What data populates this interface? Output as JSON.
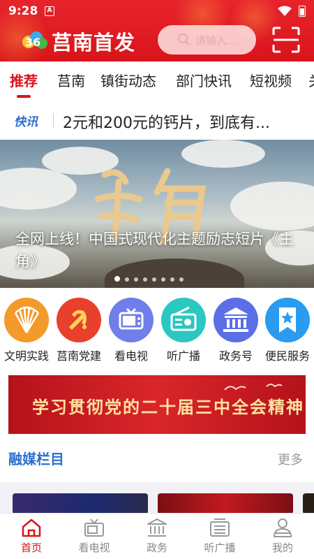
{
  "status_bar": {
    "time": "9:28",
    "app_badge": "A"
  },
  "header": {
    "brand": "莒南首发",
    "search_placeholder": "请输入..."
  },
  "tabs": [
    {
      "label": "推荐",
      "active": true
    },
    {
      "label": "莒南"
    },
    {
      "label": "镇街动态"
    },
    {
      "label": "部门快讯"
    },
    {
      "label": "短视频"
    },
    {
      "label": "关"
    }
  ],
  "flash": {
    "tag": "快讯",
    "headline": "2元和200元的钙片，到底有..."
  },
  "banner": {
    "artwork_text": "主角",
    "title": "全网上线！中国式现代化主题励志短片《主角》",
    "slide_count": 8,
    "active_slide": 1
  },
  "quick_links": [
    {
      "label": "文明实践",
      "icon": "fan-logo-icon",
      "color": "#f39a2b"
    },
    {
      "label": "莒南党建",
      "icon": "party-emblem-icon",
      "color": "#e8402b"
    },
    {
      "label": "看电视",
      "icon": "tv-icon",
      "color": "#6f7ee8"
    },
    {
      "label": "听广播",
      "icon": "radio-icon",
      "color": "#2bc7c0"
    },
    {
      "label": "政务号",
      "icon": "government-building-icon",
      "color": "#5a6ee6"
    },
    {
      "label": "便民服务",
      "icon": "bookmark-star-icon",
      "color": "#2a9bf0"
    }
  ],
  "ad_banner": {
    "text": "学习贯彻党的二十届三中全会精神"
  },
  "section": {
    "title": "融媒栏目",
    "more": "更多"
  },
  "bottom_nav": [
    {
      "label": "首页",
      "icon": "home-icon",
      "active": true
    },
    {
      "label": "看电视",
      "icon": "tv-icon"
    },
    {
      "label": "政务",
      "icon": "government-building-icon"
    },
    {
      "label": "听广播",
      "icon": "radio-icon"
    },
    {
      "label": "我的",
      "icon": "user-icon"
    }
  ],
  "colors": {
    "brand_red": "#d9141b",
    "accent_blue": "#2a6fd0"
  }
}
